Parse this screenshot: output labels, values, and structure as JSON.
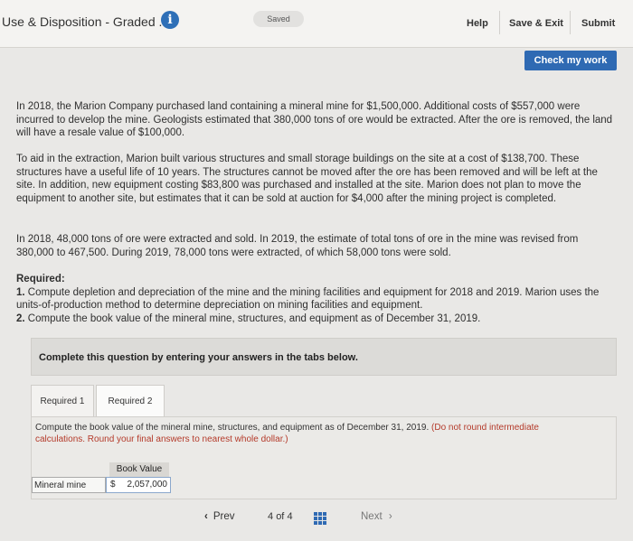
{
  "header": {
    "title": "Use & Disposition - Graded ...",
    "info_icon": "info-icon",
    "saved": "Saved",
    "help": "Help",
    "save_exit": "Save & Exit",
    "submit": "Submit"
  },
  "check_my_work": "Check my work",
  "problem": {
    "p1": "In 2018, the Marion Company purchased land containing a mineral mine for $1,500,000. Additional costs of $557,000 were incurred to develop the mine. Geologists estimated that 380,000 tons of ore would be extracted. After the ore is removed, the land will have a resale value of $100,000.",
    "p2": "To aid in the extraction, Marion built various structures and small storage buildings on the site at a cost of $138,700. These structures have a useful life of 10 years. The structures cannot be moved after the ore has been removed and will be left at the site. In addition, new equipment costing $83,800 was purchased and installed at the site. Marion does not plan to move the equipment to another site, but estimates that it can be sold at auction for $4,000 after the mining project is completed.",
    "p3": "In 2018, 48,000 tons of ore were extracted and sold. In 2019, the estimate of total tons of ore in the mine was revised from 380,000 to 467,500. During 2019, 78,000 tons were extracted, of which 58,000 tons were sold.",
    "required_heading": "Required:",
    "req1_num": "1.",
    "req1": "Compute depletion and depreciation of the mine and the mining facilities and equipment for 2018 and 2019. Marion uses the units-of-production method to determine depreciation on mining facilities and equipment.",
    "req2_num": "2.",
    "req2": "Compute the book value of the mineral mine, structures, and equipment as of December 31, 2019."
  },
  "complete_prompt": "Complete this question by entering your answers in the tabs below.",
  "tabs": [
    {
      "label": "Required 1"
    },
    {
      "label": "Required 2"
    }
  ],
  "panel": {
    "instruction": "Compute the book value of the mineral mine, structures, and equipment as of December 31, 2019.",
    "note": "(Do not round intermediate calculations. Round your final answers to nearest whole dollar.)",
    "column_header": "Book Value",
    "row_label": "Mineral mine",
    "currency": "$",
    "value": "2,057,000"
  },
  "nav": {
    "prev": "Prev",
    "page_current": "4",
    "page_of": "of",
    "page_total": "4",
    "next": "Next",
    "grid_icon": "grid-icon"
  }
}
